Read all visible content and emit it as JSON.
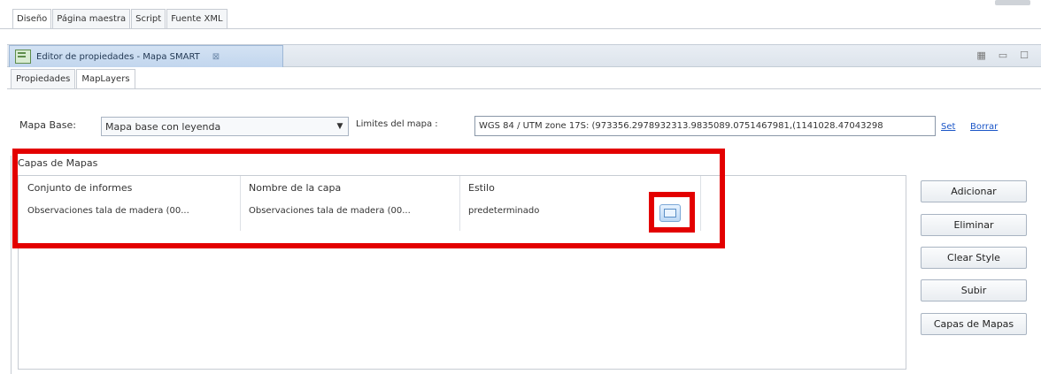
{
  "editor_tabs": [
    "Diseño",
    "Página maestra",
    "Script",
    "Fuente XML"
  ],
  "view": {
    "title": "Editor de propiedades - Mapa SMART",
    "close_glyph": "⊠",
    "actions": [
      "▦",
      "▭",
      "☐"
    ]
  },
  "sub_tabs": [
    "Propiedades",
    "MapLayers"
  ],
  "map_base": {
    "label": "Mapa Base:",
    "value": "Mapa base con leyenda"
  },
  "limits": {
    "label": "Limites del mapa :",
    "value": "WGS 84 / UTM zone 17S: (973356.2978932313.9835089.0751467981,(1141028.47043298",
    "set_label": "Set",
    "clear_label": "Borrar"
  },
  "layers": {
    "group_title": "Capas de Mapas",
    "columns": [
      "Conjunto de informes",
      "Nombre de la capa",
      "Estilo"
    ],
    "rows": [
      {
        "report_set": "Observaciones tala de madera (00...",
        "layer_name": "Observaciones tala de madera (00...",
        "style": "predeterminado"
      }
    ]
  },
  "buttons": {
    "add": "Adicionar",
    "remove": "Eliminar",
    "clear_style": "Clear Style",
    "up": "Subir",
    "map_layers": "Capas de Mapas"
  },
  "colors": {
    "highlight": "#e30000",
    "link": "#1a55c7",
    "active_view_tab": "#c2d6ee"
  }
}
